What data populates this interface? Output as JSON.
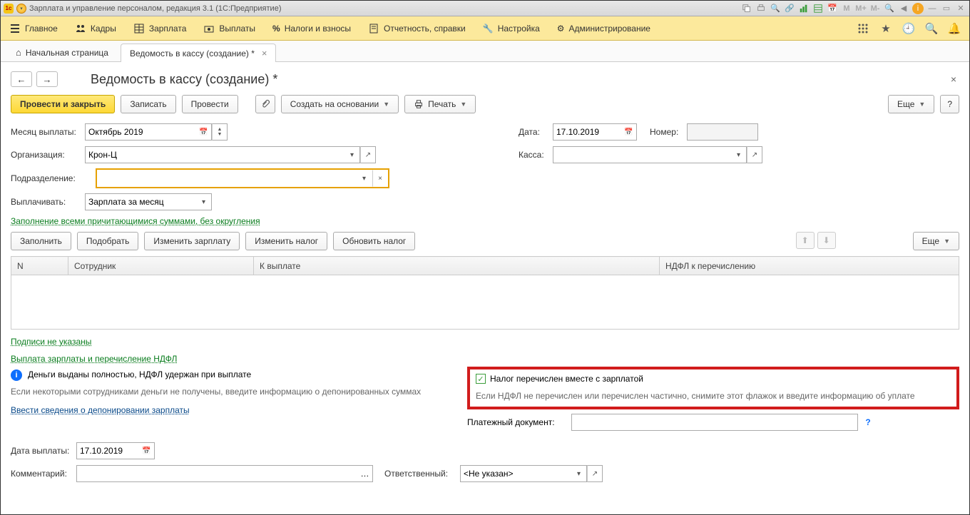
{
  "titlebar": {
    "text": "Зарплата и управление персоналом, редакция 3.1  (1С:Предприятие)"
  },
  "sysicons": {
    "m1": "M",
    "m2": "M+",
    "m3": "M-"
  },
  "nav": {
    "items": [
      {
        "label": "Главное"
      },
      {
        "label": "Кадры"
      },
      {
        "label": "Зарплата"
      },
      {
        "label": "Выплаты"
      },
      {
        "label": "Налоги и взносы"
      },
      {
        "label": "Отчетность, справки"
      },
      {
        "label": "Настройка"
      },
      {
        "label": "Администрирование"
      }
    ]
  },
  "tabs": {
    "home": "Начальная страница",
    "current": "Ведомость в кассу (создание) *"
  },
  "page": {
    "title": "Ведомость в кассу (создание) *"
  },
  "toolbar": {
    "post_close": "Провести и закрыть",
    "write": "Записать",
    "post": "Провести",
    "create_based": "Создать на основании",
    "print": "Печать",
    "more": "Еще",
    "help": "?"
  },
  "form": {
    "month_label": "Месяц выплаты:",
    "month_value": "Октябрь 2019",
    "date_label": "Дата:",
    "date_value": "17.10.2019",
    "number_label": "Номер:",
    "number_value": "",
    "org_label": "Организация:",
    "org_value": "Крон-Ц",
    "kassa_label": "Касса:",
    "kassa_value": "",
    "dept_label": "Подразделение:",
    "dept_value": "",
    "pay_label": "Выплачивать:",
    "pay_value": "Зарплата за месяц",
    "fill_link": "Заполнение всеми причитающимися суммами, без округления"
  },
  "sec_toolbar": {
    "fill": "Заполнить",
    "pick": "Подобрать",
    "change_salary": "Изменить зарплату",
    "change_tax": "Изменить налог",
    "update_tax": "Обновить налог",
    "more": "Еще"
  },
  "table": {
    "columns": [
      "N",
      "Сотрудник",
      "К выплате",
      "НДФЛ к перечислению"
    ]
  },
  "links": {
    "signs": "Подписи не указаны",
    "payout_heading": "Выплата зарплаты и перечисление НДФЛ",
    "depo": "Ввести сведения о депонировании зарплаты"
  },
  "info": {
    "line1": "Деньги выданы полностью, НДФЛ удержан при выплате",
    "line2": "Если некоторыми сотрудниками деньги не получены, введите информацию о депонированных суммах"
  },
  "redbox": {
    "check": "Налог перечислен вместе с зарплатой",
    "note": "Если НДФЛ не перечислен или перечислен частично, снимите этот флажок и введите информацию об уплате"
  },
  "payment_doc": {
    "label": "Платежный документ:",
    "value": ""
  },
  "pay_date": {
    "label": "Дата выплаты:",
    "value": "17.10.2019"
  },
  "comment": {
    "label": "Комментарий:",
    "value": ""
  },
  "responsible": {
    "label": "Ответственный:",
    "value": "<Не указан>"
  }
}
